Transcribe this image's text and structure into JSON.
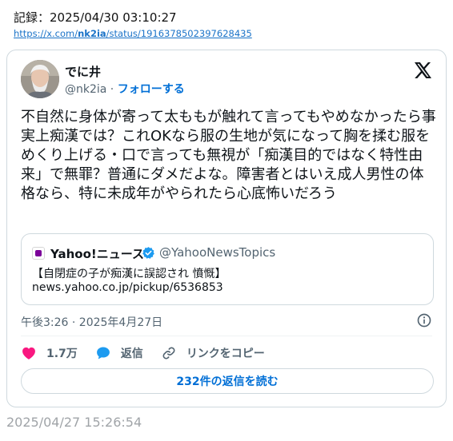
{
  "record": {
    "label": "記録：2025/04/30 03:10:27",
    "url_prefix": "https://x.com/",
    "url_handle": "nk2ia",
    "url_suffix": "/status/1916378502397628435"
  },
  "tweet": {
    "author_name": "でに井",
    "author_handle": "@nk2ia",
    "separator": " · ",
    "follow_label": "フォローする",
    "text": "不自然に身体が寄って太ももが触れて言ってもやめなかったら事実上痴漢では？これOKなら服の生地が気になって胸を揉む服をめくり上げる・口で言っても無視が「痴漢目的ではなく特性由来」で無罪？普通にダメだよな。障害者とはいえ成人男性の体格なら、特に未成年がやられたら心底怖いだろう",
    "timestamp": "午後3:26 · 2025年4月27日"
  },
  "quote": {
    "source_name": "Yahoo!ニュース",
    "source_handle": "@YahooNewsTopics",
    "title": "【自閉症の子が痴漢に誤認され 憤慨】",
    "url": "news.yahoo.co.jp/pickup/6536853"
  },
  "actions": {
    "likes": "1.7万",
    "reply_label": "返信",
    "copy_link_label": "リンクをコピー"
  },
  "read_replies_label": "232件の返信を読む",
  "footer_date": "2025/04/27 15:26:54",
  "icons": {
    "x_logo": "x-logo-icon",
    "verified": "verified-badge-icon",
    "info": "info-icon",
    "like": "heart-icon",
    "reply": "speech-bubble-icon",
    "link": "link-icon"
  },
  "colors": {
    "link_blue": "#006fd6",
    "like_pink": "#f91880",
    "reply_blue": "#1d9bf0",
    "border": "#cfd9de",
    "muted": "#536471"
  }
}
